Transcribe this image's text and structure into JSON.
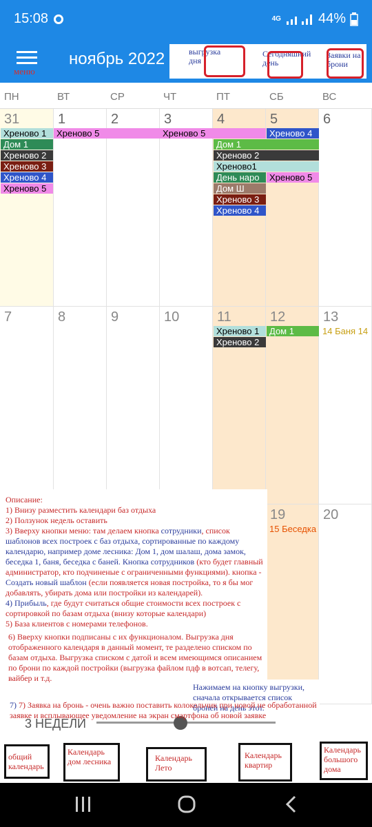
{
  "status": {
    "time": "15:08",
    "network": "4G",
    "battery": "44%"
  },
  "header": {
    "menu_label": "меню",
    "month": "ноябрь 2022",
    "btn_export": "выгрузка дня",
    "btn_today": "Сегодняшний день",
    "btn_bookings": "Заявки на брони"
  },
  "weekdays": [
    "ПН",
    "ВТ",
    "СР",
    "ЧТ",
    "ПТ",
    "СБ",
    "ВС"
  ],
  "week1": {
    "days": [
      "31",
      "1",
      "2",
      "3",
      "4",
      "5",
      "6"
    ],
    "events": [
      "Хреново 1",
      "Хреново 5",
      "Хреново 5",
      "Хреново 4",
      "Дом 1",
      "Дом 1",
      "Хреново 2",
      "Хреново 2",
      "Хреново 3",
      "Хреново1",
      "Хреново 4",
      "День наро",
      "Хреново 5",
      "Хреново 5",
      "Дом Ш",
      "Хреново 3",
      "Хреново 4"
    ]
  },
  "week2": {
    "days": [
      "7",
      "8",
      "9",
      "10",
      "11",
      "12",
      "13"
    ],
    "events": [
      "Хреново 1",
      "Дом 1",
      "14 Баня 14",
      "Хреново 2"
    ]
  },
  "week3": {
    "days": [
      "19",
      "20"
    ],
    "events": [
      "15 Беседка"
    ]
  },
  "notes": {
    "title": "Описание:",
    "p1": "1) Внизу разместить календари баз отдыха",
    "p2": "2) Ползунок недель оставить",
    "p3a": "3) Вверху кнопки меню: там делаем кнопка ",
    "p3b": "сотрудники",
    "p3c": ", список ",
    "p3d": "шаблонов всех построек с баз отдыха, сортированные по каждому календарю, например доме лесника: Дом 1, дом шалаш, дома замок, беседка 1, баня, беседка с баней. ",
    "p3e": "Кнопка сотрудников",
    "p3f": " (кто будет главный администратор, кто подчиненые с ограниченными функциями). кнопка - ",
    "p3g": "Создать новый шаблон",
    "p3h": " (если появляется новая постройка, то я бы мог добавлять, убирать дома или постройки из календарей).",
    "p4a": "4) ",
    "p4b": "Прибыль",
    "p4c": ", где будут считаться общие стоимости всех построек с сортировкой по базам отдыха (внизу которые календари)",
    "p5": "5) База клиентов с номерами телефонов.",
    "p6": "6) Вверху кнопки подписаны с их функционалом. Выгрузка дня отображенного календаря в данный момент, те разделено списком по базам отдыха. Выгрузка списком с датой и всем имеющимся описанием по брони по каждой постройки (выгрузка файлом пдф в вотсап, телегу, вайбер и т.д.",
    "p7": "7) Заявка на бронь - очень важно поставить колокольчик при новой не обработанной заявке и всплывающее уведомление на экран смартфона об новой заявке"
  },
  "tooltip": "Нажимаем на кнопку выгрузки, сначала открывается список броней на день этот.",
  "slider": {
    "label": "3 НЕДЕЛИ",
    "position": 0.55
  },
  "bottom_calendars": [
    "общий календарь",
    "Календарь дом лесника",
    "Календарь Лето",
    "Календарь квартир",
    "Календарь большого дома"
  ]
}
